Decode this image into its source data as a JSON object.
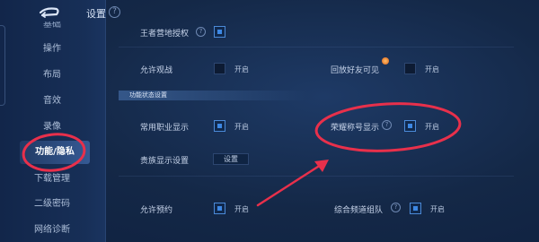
{
  "header": {
    "title": "设置"
  },
  "sidebar": {
    "items": [
      {
        "label": "基础"
      },
      {
        "label": "操作"
      },
      {
        "label": "布局"
      },
      {
        "label": "音效"
      },
      {
        "label": "录像"
      },
      {
        "label": "功能/隐私"
      },
      {
        "label": "下载管理"
      },
      {
        "label": "二级密码"
      },
      {
        "label": "网络诊断"
      }
    ]
  },
  "settings": {
    "camp_auth": {
      "label": "王者营地授权",
      "checked": true
    },
    "allow_watch": {
      "label": "允许观战",
      "state_text": "开启",
      "checked": false
    },
    "replay_friends": {
      "label": "回放好友可见",
      "state_text": "开启",
      "checked": false
    },
    "section_title": "功能状态设置",
    "profession_display": {
      "label": "常用职业显示",
      "state_text": "开启",
      "checked": true
    },
    "honor_title_display": {
      "label": "荣耀称号显示",
      "state_text": "开启",
      "checked": true
    },
    "noble_display": {
      "label": "贵族显示设置",
      "button_label": "设置"
    },
    "allow_appointment": {
      "label": "允许预约",
      "state_text": "开启",
      "checked": true
    },
    "channel_team": {
      "label": "综合频道组队",
      "state_text": "开启",
      "checked": true
    }
  },
  "annotations": {
    "color": "#e8304b"
  },
  "colors": {
    "accent": "#3d88e4",
    "background": "#152a4d"
  }
}
